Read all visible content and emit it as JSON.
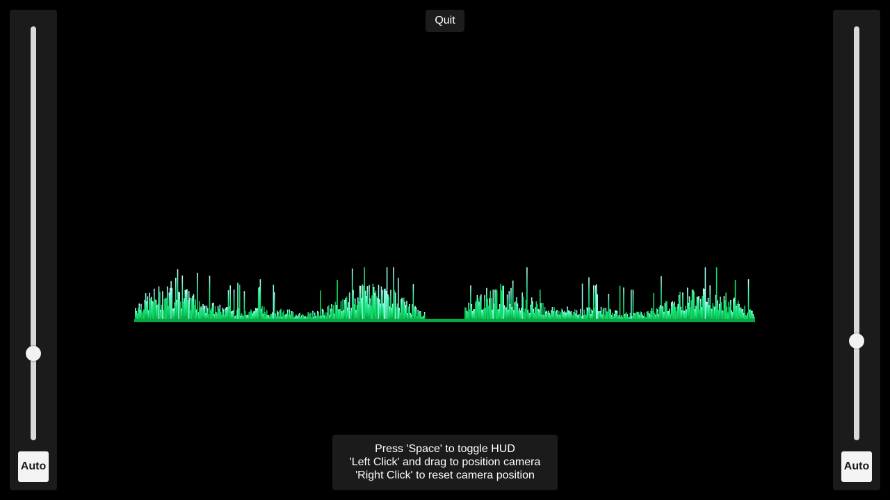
{
  "quit_button": {
    "label": "Quit"
  },
  "left_panel": {
    "slider_value": 0.21,
    "auto_label": "Auto"
  },
  "right_panel": {
    "slider_value": 0.24,
    "auto_label": "Auto"
  },
  "help": {
    "line1": "Press 'Space' to toggle HUD",
    "line2": "'Left Click' and drag to position camera",
    "line3": "'Right Click' to reset camera position"
  },
  "colors": {
    "background": "#000000",
    "panel": "#1b1b1b",
    "bar_low": "#00c853",
    "bar_mid": "#19e68c",
    "bar_high": "#9ffff0"
  }
}
